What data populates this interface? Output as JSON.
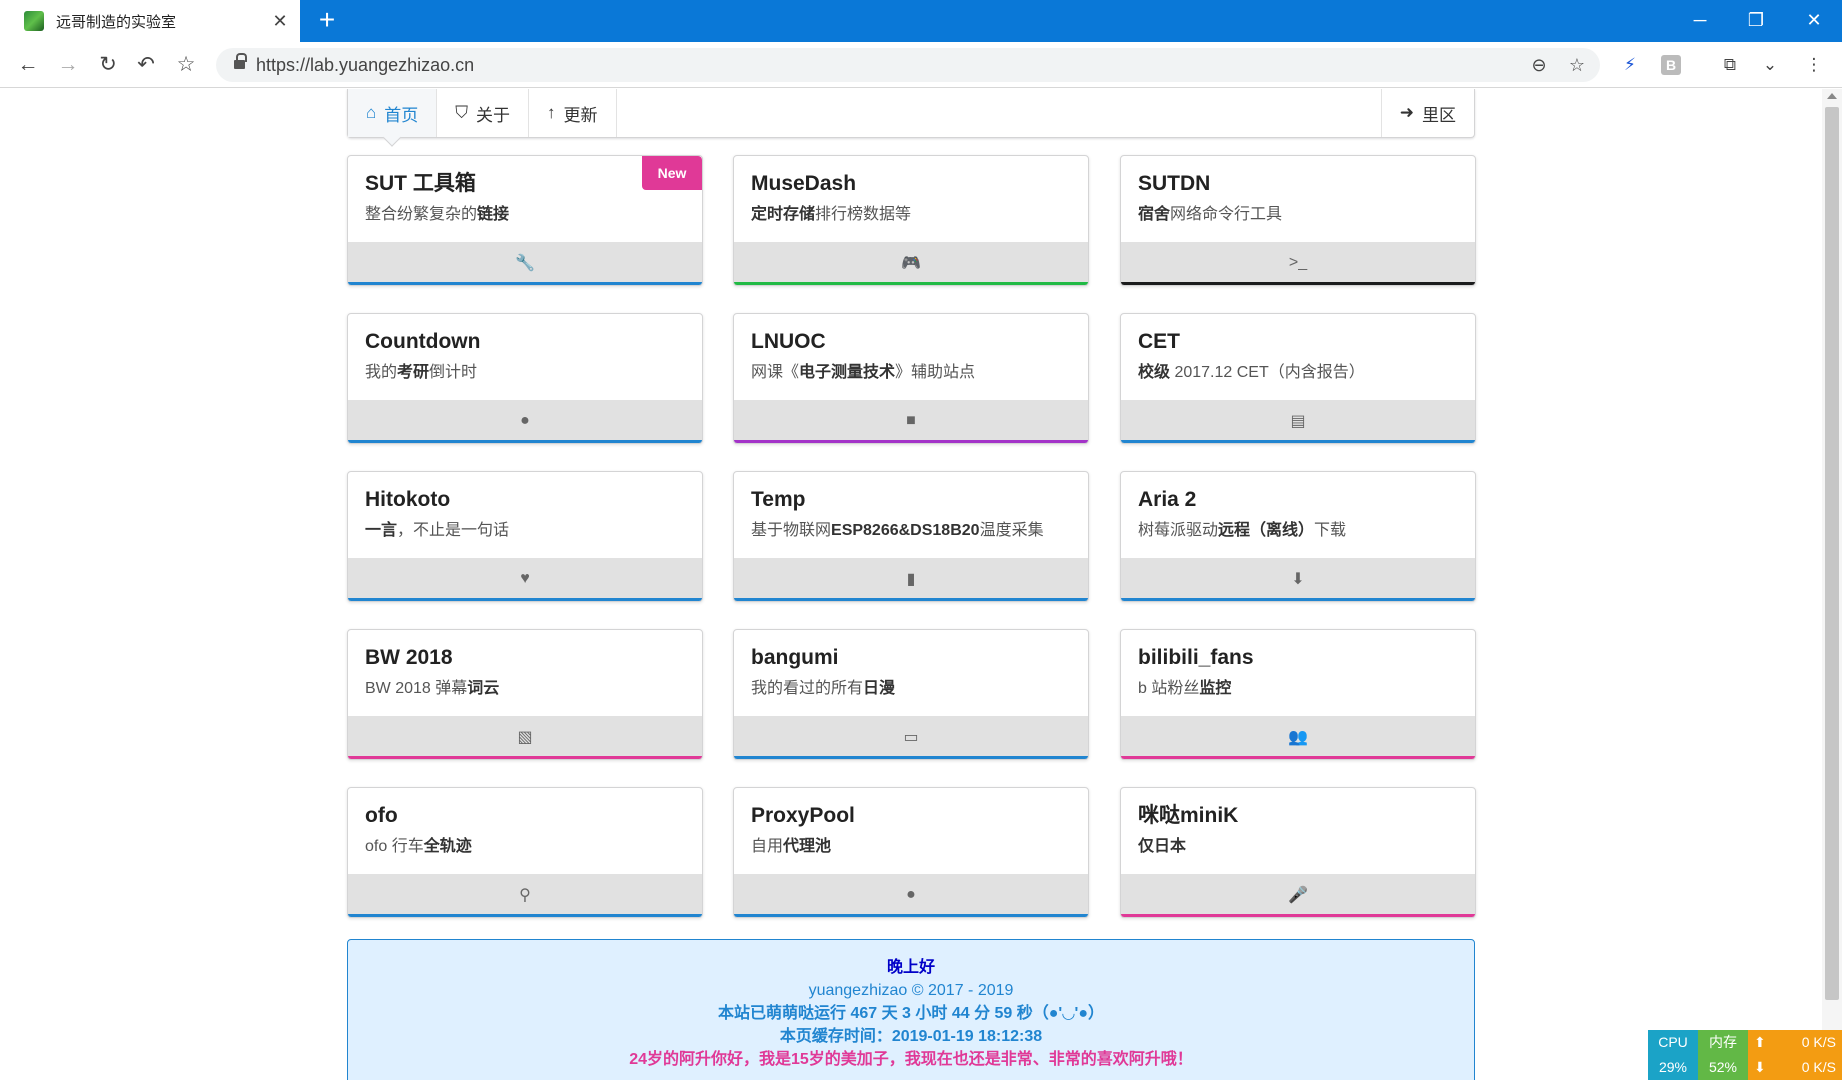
{
  "browser": {
    "tab_title": "远哥制造的实验室",
    "tab_close": "✕",
    "new_tab": "+",
    "url": "https://lab.yuangezhizao.cn",
    "min": "─",
    "restore": "❐",
    "close": "✕"
  },
  "nav": {
    "items": [
      {
        "label": "首页",
        "icon": "home-icon",
        "glyph": "⌂",
        "active": true
      },
      {
        "label": "关于",
        "icon": "html5-icon",
        "glyph": "⛉",
        "active": false
      },
      {
        "label": "更新",
        "icon": "arrow-up-icon",
        "glyph": "↑",
        "active": false
      }
    ],
    "right": {
      "label": "里区",
      "icon": "sign-in-icon",
      "glyph": "➜"
    }
  },
  "cards": [
    {
      "title": "SUT 工具箱",
      "desc_parts": [
        "整合纷繁复杂的",
        "链接",
        ""
      ],
      "icon": "wrench-icon",
      "glyph": "🔧",
      "color": "#2185d0",
      "new": "New"
    },
    {
      "title": "MuseDash",
      "desc_parts": [
        "",
        "定时存储",
        "排行榜数据等"
      ],
      "icon": "gamepad-icon",
      "glyph": "🎮",
      "color": "#21ba45"
    },
    {
      "title": "SUTDN",
      "desc_parts": [
        "",
        "宿舍",
        "网络命令行工具"
      ],
      "icon": "terminal-icon",
      "glyph": ">_",
      "color": "#1b1c1d"
    },
    {
      "title": "Countdown",
      "desc_parts": [
        "我的",
        "考研",
        "倒计时"
      ],
      "icon": "clock-icon",
      "glyph": "●",
      "color": "#2185d0"
    },
    {
      "title": "LNUOC",
      "desc_parts": [
        "网课《",
        "电子测量技术",
        "》辅助站点"
      ],
      "icon": "video-camera-icon",
      "glyph": "■",
      "color": "#a333c8"
    },
    {
      "title": "CET",
      "desc_parts": [
        "",
        "校级",
        " 2017.12 CET（内含报告）"
      ],
      "icon": "table-icon",
      "glyph": "▤",
      "color": "#2185d0"
    },
    {
      "title": "Hitokoto",
      "desc_parts": [
        "",
        "一言",
        "，不止是一句话"
      ],
      "icon": "heart-icon",
      "glyph": "♥",
      "color": "#2185d0"
    },
    {
      "title": "Temp",
      "desc_parts": [
        "基于物联网",
        "ESP8266&DS18B20",
        "温度采集"
      ],
      "icon": "thermometer-icon",
      "glyph": "▮",
      "color": "#2185d0"
    },
    {
      "title": "Aria 2",
      "desc_parts": [
        "树莓派驱动",
        "远程（离线）",
        "下载"
      ],
      "icon": "download-icon",
      "glyph": "⬇",
      "color": "#2185d0"
    },
    {
      "title": "BW 2018",
      "desc_parts": [
        "BW 2018 弹幕",
        "词云",
        ""
      ],
      "icon": "image-icon",
      "glyph": "▧",
      "color": "#e03997"
    },
    {
      "title": "bangumi",
      "desc_parts": [
        "我的看过的所有",
        "日漫",
        ""
      ],
      "icon": "desktop-icon",
      "glyph": "▭",
      "color": "#2185d0"
    },
    {
      "title": "bilibili_fans",
      "desc_parts": [
        "b 站粉丝",
        "监控",
        ""
      ],
      "icon": "users-icon",
      "glyph": "👥",
      "color": "#e03997"
    },
    {
      "title": "ofo",
      "desc_parts": [
        "ofo 行车",
        "全轨迹",
        ""
      ],
      "icon": "bicycle-icon",
      "glyph": "⚲",
      "color": "#2185d0"
    },
    {
      "title": "ProxyPool",
      "desc_parts": [
        "自用",
        "代理池",
        ""
      ],
      "icon": "circle-icon",
      "glyph": "●",
      "color": "#2185d0"
    },
    {
      "title": "咪哒miniK",
      "desc_parts": [
        "",
        "仅日本",
        ""
      ],
      "icon": "microphone-icon",
      "glyph": "🎤",
      "color": "#e03997"
    }
  ],
  "footer": {
    "greeting": "晚上好",
    "copyright": "yuangezhizao   ©   2017 - 2019",
    "uptime": "本站已萌萌哒运行 467 天 3 小时 44 分 59 秒（●'◡'●）",
    "cache": "本页缓存时间：2019-01-19 18:12:38",
    "message": "24岁的阿升你好，我是15岁的美加子，我现在也还是非常、非常的喜欢阿升哦！"
  },
  "monitor": {
    "cpu_label": "CPU",
    "cpu_value": "29%",
    "mem_label": "内存",
    "mem_value": "52%",
    "up": "0 K/S",
    "down": "0 K/S"
  }
}
